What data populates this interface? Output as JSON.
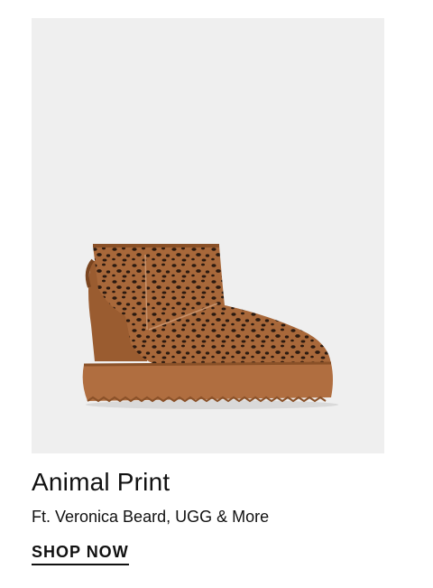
{
  "promo": {
    "title": "Animal Print",
    "subtitle": "Ft. Veronica Beard, UGG & More",
    "cta_label": "SHOP NOW"
  },
  "image": {
    "icon": "leopard-print-platform-boot",
    "colors": {
      "background": "#efefef",
      "boot_tan": "#a8683a",
      "boot_dark": "#8a5128",
      "sole": "#b06e40",
      "spots": "#2b1a10"
    }
  }
}
